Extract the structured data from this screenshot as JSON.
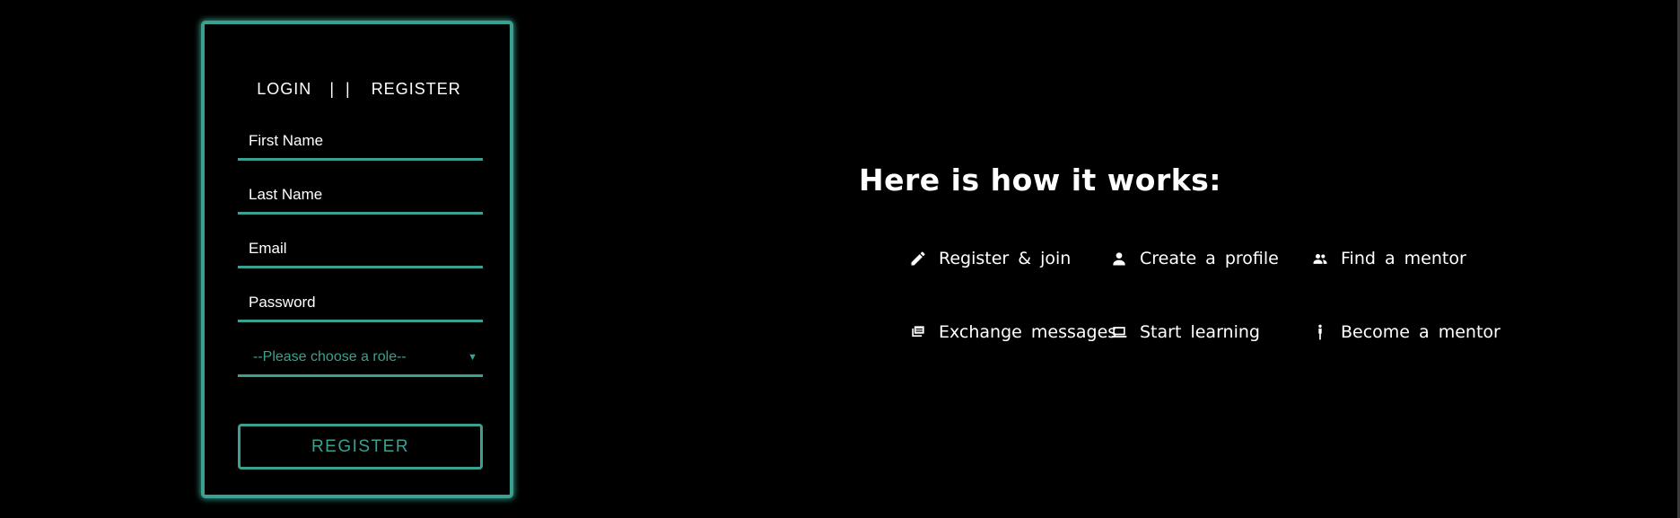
{
  "auth": {
    "login_tab": "LOGIN",
    "separator": "| |",
    "register_tab": "REGISTER"
  },
  "form": {
    "first_name_placeholder": "First Name",
    "last_name_placeholder": "Last Name",
    "email_placeholder": "Email",
    "password_placeholder": "Password",
    "role_select": {
      "selected": "--Please choose a role--",
      "caret": "▼"
    },
    "submit_label": "REGISTER"
  },
  "how_it_works": {
    "title": "Here is how it works:",
    "steps": [
      {
        "label": "Register & join",
        "icon": "pencil-icon"
      },
      {
        "label": "Create a profile",
        "icon": "person-icon"
      },
      {
        "label": "Find a mentor",
        "icon": "people-icon"
      },
      {
        "label": "Exchange messages",
        "icon": "chat-icon"
      },
      {
        "label": "Start learning",
        "icon": "laptop-icon"
      },
      {
        "label": "Become a mentor",
        "icon": "standing-person-icon"
      }
    ]
  },
  "colors": {
    "accent": "#3aa08f",
    "background": "#000000",
    "text": "#ffffff"
  }
}
